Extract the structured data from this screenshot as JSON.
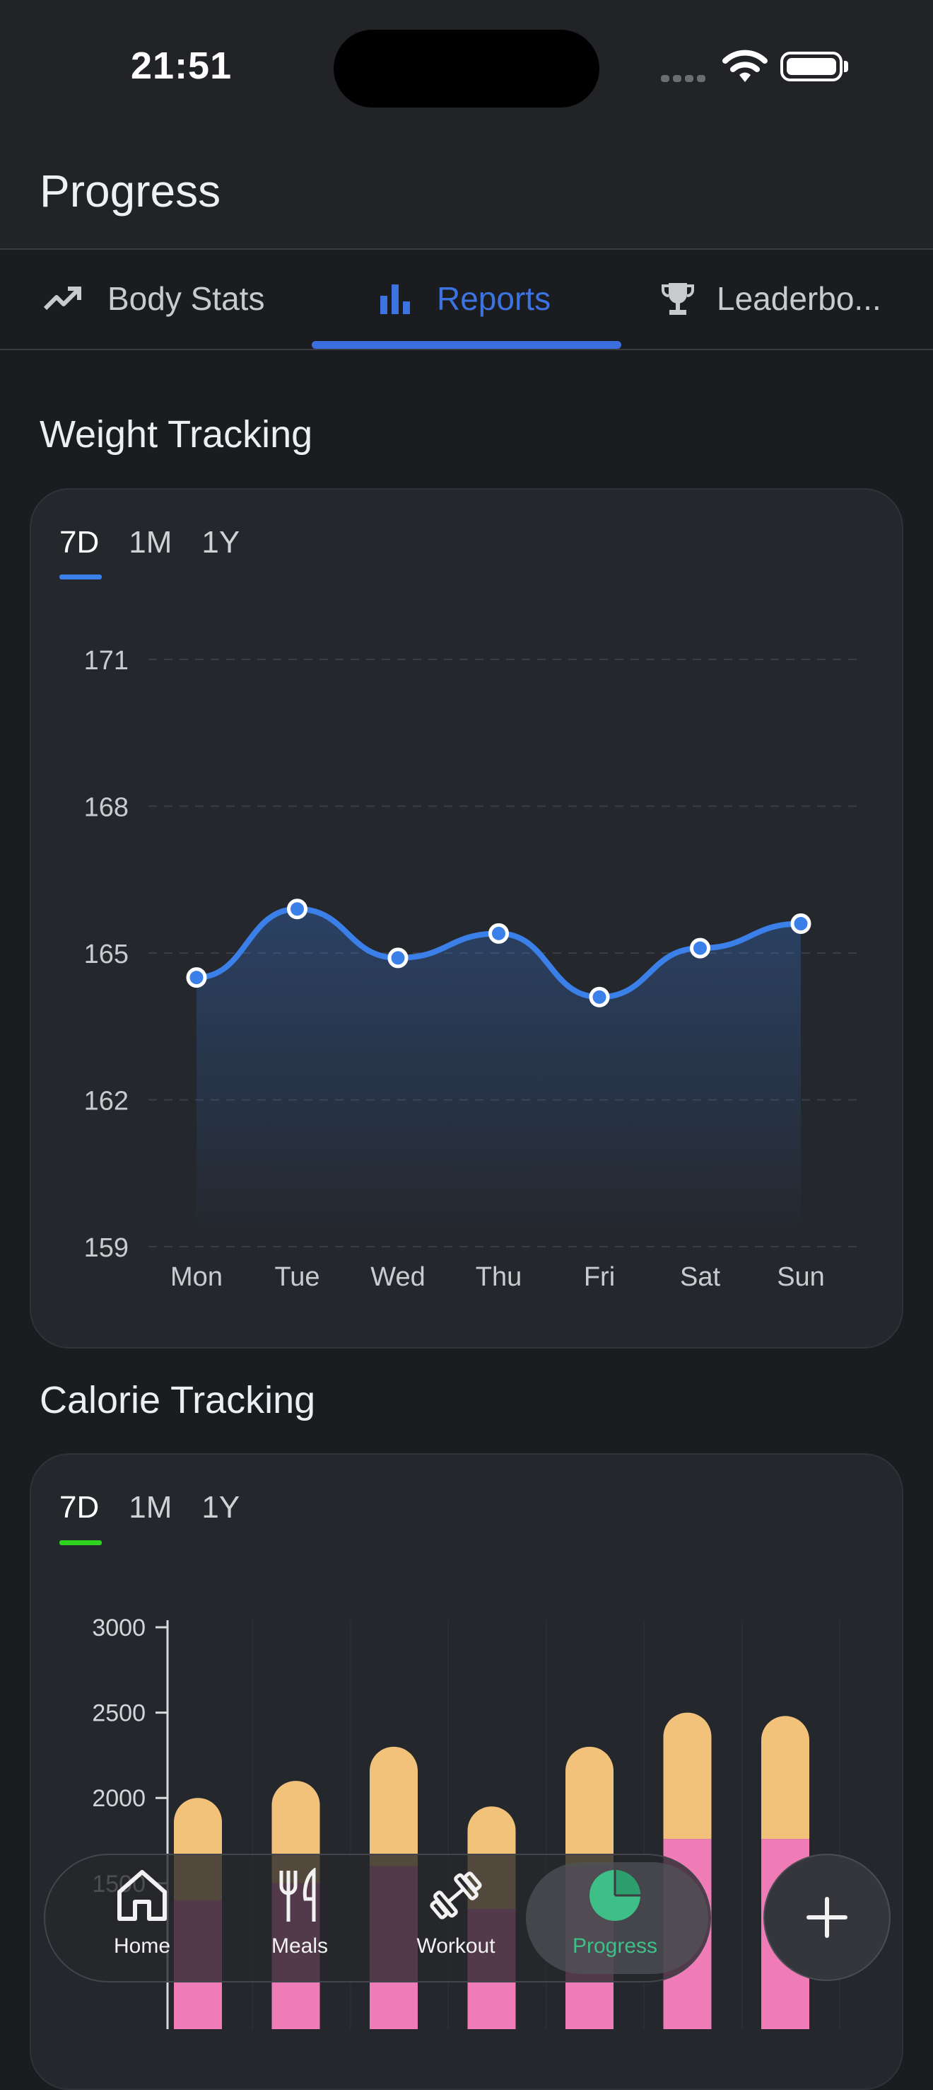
{
  "status_bar": {
    "time": "21:51"
  },
  "header": {
    "title": "Progress"
  },
  "tabs": [
    {
      "label": "Body Stats",
      "icon": "trending-up-icon",
      "active": false
    },
    {
      "label": "Reports",
      "icon": "bar-chart-icon",
      "active": true
    },
    {
      "label": "Leaderbo...",
      "icon": "trophy-icon",
      "active": false
    }
  ],
  "weight": {
    "title": "Weight Tracking",
    "ranges": [
      "7D",
      "1M",
      "1Y"
    ],
    "selected_range": "7D",
    "accent": "#3b7fe8"
  },
  "calorie": {
    "title": "Calorie Tracking",
    "ranges": [
      "7D",
      "1M",
      "1Y"
    ],
    "selected_range": "7D",
    "accent": "#2fd21f"
  },
  "chart_data": [
    {
      "type": "area",
      "categories": [
        "Mon",
        "Tue",
        "Wed",
        "Thu",
        "Fri",
        "Sat",
        "Sun"
      ],
      "values": [
        164.5,
        165.9,
        164.9,
        165.4,
        164.1,
        165.1,
        165.6
      ],
      "yticks": [
        171,
        168,
        165,
        162,
        159
      ],
      "ylim": [
        159,
        171
      ],
      "grid": true,
      "color": "#3b7fe8"
    },
    {
      "type": "bar",
      "stacked": true,
      "categories": [
        "Mon",
        "Tue",
        "Wed",
        "Thu",
        "Fri",
        "Sat",
        "Sun"
      ],
      "yticks": [
        3000,
        2500,
        2000,
        1500
      ],
      "ylim": [
        1000,
        3000
      ],
      "series": [
        {
          "color": "#3a6fe8",
          "values": [
            0,
            0,
            60,
            0,
            60,
            100,
            100
          ]
        },
        {
          "color": "#ef7cb6",
          "values": [
            1400,
            1500,
            1540,
            1350,
            1540,
            1660,
            1660
          ]
        },
        {
          "color": "#f2c27b",
          "values": [
            600,
            600,
            700,
            600,
            700,
            740,
            720
          ]
        }
      ]
    }
  ],
  "bottom_nav": {
    "items": [
      {
        "label": "Home",
        "icon": "home-icon",
        "active": false
      },
      {
        "label": "Meals",
        "icon": "fork-knife-icon",
        "active": false
      },
      {
        "label": "Workout",
        "icon": "dumbbell-icon",
        "active": false
      },
      {
        "label": "Progress",
        "icon": "pie-chart-icon",
        "active": true
      }
    ],
    "fab_icon": "plus-icon"
  }
}
